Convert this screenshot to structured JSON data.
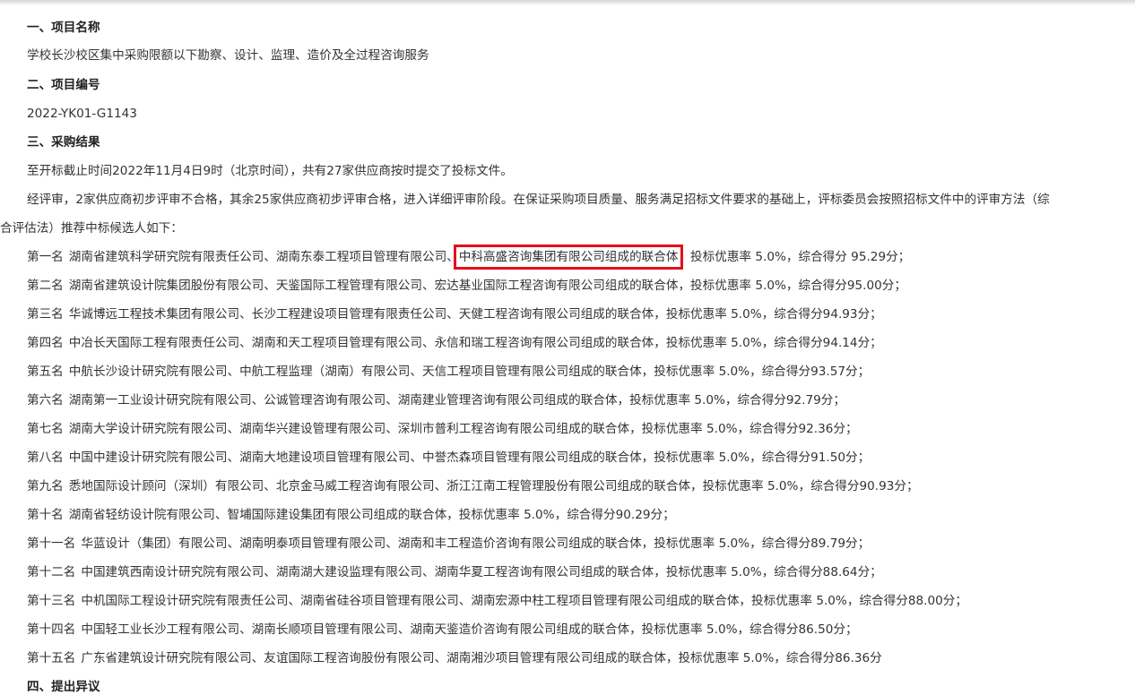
{
  "sections": {
    "project_name_heading": "一、项目名称",
    "project_name": "学校长沙校区集中采购限额以下勘察、设计、监理、造价及全过程咨询服务",
    "project_number_heading": "二、项目编号",
    "project_number": "2022-YK01-G1143",
    "result_heading": "三、采购结果",
    "deadline_text": "至开标截止时间2022年11月4日9时（北京时间），共有27家供应商按时提交了投标文件。",
    "review_text_line1": "经评审，2家供应商初步评审不合格，其余25家供应商初步评审合格，进入详细评审阶段。在保证采购项目质量、服务满足招标文件要求的基础上，评标委员会按照招标文件中的评审方法（综",
    "review_text_line2": "合评估法）推荐中标候选人如下：",
    "objection_heading": "四、提出异议"
  },
  "rankings": [
    {
      "rank": "第一名",
      "pre": "湖南省建筑科学研究院有限责任公司、湖南东泰工程项目管理有限公司、",
      "highlight": "中科高盛咨询集团有限公司组成的联合体",
      "post": "，投标优惠率 5.0%，综合得分 95.29分；"
    },
    {
      "rank": "第二名",
      "text": "湖南省建筑设计院集团股份有限公司、天鉴国际工程管理有限公司、宏达基业国际工程咨询有限公司组成的联合体，投标优惠率 5.0%，综合得分95.00分；"
    },
    {
      "rank": "第三名",
      "text": "华诚博远工程技术集团有限公司、长沙工程建设项目管理有限责任公司、天健工程咨询有限公司组成的联合体，投标优惠率 5.0%，综合得分94.93分；"
    },
    {
      "rank": "第四名",
      "text": "中冶长天国际工程有限责任公司、湖南和天工程项目管理有限公司、永信和瑞工程咨询有限公司组成的联合体，投标优惠率 5.0%，综合得分94.14分；"
    },
    {
      "rank": "第五名",
      "text": "中航长沙设计研究院有限公司、中航工程监理（湖南）有限公司、天信工程项目管理有限公司组成的联合体，投标优惠率 5.0%，综合得分93.57分；"
    },
    {
      "rank": "第六名",
      "text": "湖南第一工业设计研究院有限公司、公诚管理咨询有限公司、湖南建业管理咨询有限公司组成的联合体，投标优惠率 5.0%，综合得分92.79分；"
    },
    {
      "rank": "第七名",
      "text": "湖南大学设计研究院有限公司、湖南华兴建设管理有限公司、深圳市普利工程咨询有限公司组成的联合体，投标优惠率 5.0%，综合得分92.36分；"
    },
    {
      "rank": "第八名",
      "text": "中国中建设计研究院有限公司、湖南大地建设项目管理有限公司、中誉杰森项目管理有限公司组成的联合体，投标优惠率 5.0%，综合得分91.50分；"
    },
    {
      "rank": "第九名",
      "text": "悉地国际设计顾问（深圳）有限公司、北京金马威工程咨询有限公司、浙江江南工程管理股份有限公司组成的联合体，投标优惠率 5.0%，综合得分90.93分；"
    },
    {
      "rank": "第十名",
      "text": "湖南省轻纺设计院有限公司、智埔国际建设集团有限公司组成的联合体，投标优惠率 5.0%，综合得分90.29分；"
    },
    {
      "rank": "第十一名",
      "text": "华蓝设计（集团）有限公司、湖南明泰项目管理有限公司、湖南和丰工程造价咨询有限公司组成的联合体，投标优惠率 5.0%，综合得分89.79分；"
    },
    {
      "rank": "第十二名",
      "text": "中国建筑西南设计研究院有限公司、湖南湖大建设监理有限公司、湖南华夏工程咨询有限公司组成的联合体，投标优惠率 5.0%，综合得分88.64分；"
    },
    {
      "rank": "第十三名",
      "text": "中机国际工程设计研究院有限责任公司、湖南省硅谷项目管理有限公司、湖南宏源中柱工程项目管理有限公司组成的联合体，投标优惠率 5.0%，综合得分88.00分；"
    },
    {
      "rank": "第十四名",
      "text": "中国轻工业长沙工程有限公司、湖南长顺项目管理有限公司、湖南天鉴造价咨询有限公司组成的联合体，投标优惠率 5.0%，综合得分86.50分；"
    },
    {
      "rank": "第十五名",
      "text": "广东省建筑设计研究院有限公司、友谊国际工程咨询股份有限公司、湖南湘沙项目管理有限公司组成的联合体，投标优惠率 5.0%，综合得分86.36分"
    }
  ],
  "colors": {
    "text": "#333333",
    "highlight_border": "#e3101a"
  }
}
